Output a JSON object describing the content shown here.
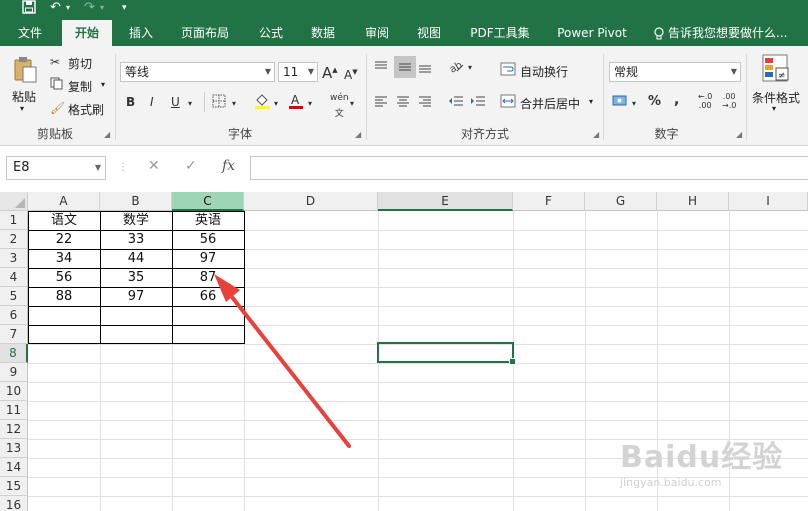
{
  "titlebar": {
    "save_icon": "save-icon",
    "undo_icon": "undo-icon",
    "redo_icon": "redo-icon"
  },
  "tabs": [
    {
      "label": "文件"
    },
    {
      "label": "开始"
    },
    {
      "label": "插入"
    },
    {
      "label": "页面布局"
    },
    {
      "label": "公式"
    },
    {
      "label": "数据"
    },
    {
      "label": "审阅"
    },
    {
      "label": "视图"
    },
    {
      "label": "PDF工具集"
    },
    {
      "label": "Power Pivot"
    },
    {
      "label": "告诉我您想要做什么..."
    }
  ],
  "clipboard": {
    "paste_label": "粘贴",
    "cut_label": "剪切",
    "copy_label": "复制",
    "format_painter_label": "格式刷",
    "group_label": "剪贴板"
  },
  "font": {
    "font_name": "等线",
    "font_size": "11",
    "grow_label": "A",
    "shrink_label": "A",
    "bold_label": "B",
    "italic_label": "I",
    "underline_label": "U",
    "phonetic_label": "wén",
    "group_label": "字体"
  },
  "alignment": {
    "wrap_text_label": "自动换行",
    "merge_center_label": "合并后居中",
    "group_label": "对齐方式"
  },
  "number": {
    "format": "常规",
    "percent_label": "%",
    "comma_label": ",",
    "group_label": "数字"
  },
  "styles": {
    "conditional_label": "条件格式"
  },
  "formula_bar": {
    "name_box": "E8",
    "fx_label": "fx",
    "cancel_label": "✕",
    "enter_label": "✓",
    "value": ""
  },
  "sheet": {
    "columns": [
      "A",
      "B",
      "C",
      "D",
      "E",
      "F",
      "G",
      "H",
      "I"
    ],
    "rows": [
      "1",
      "2",
      "3",
      "4",
      "5",
      "6",
      "7",
      "8",
      "9",
      "10",
      "11",
      "12",
      "13",
      "14",
      "15",
      "16"
    ],
    "active_cell": "E8",
    "table": [
      [
        "语文",
        "数学",
        "英语"
      ],
      [
        "22",
        "33",
        "56"
      ],
      [
        "34",
        "44",
        "97"
      ],
      [
        "56",
        "35",
        "87"
      ],
      [
        "88",
        "97",
        "66"
      ],
      [
        "",
        "",
        ""
      ],
      [
        "",
        "",
        ""
      ]
    ],
    "annotation_color": "#e8413c"
  },
  "watermark": {
    "main": "Baidu经验",
    "url": "jingyan.baidu.com"
  }
}
